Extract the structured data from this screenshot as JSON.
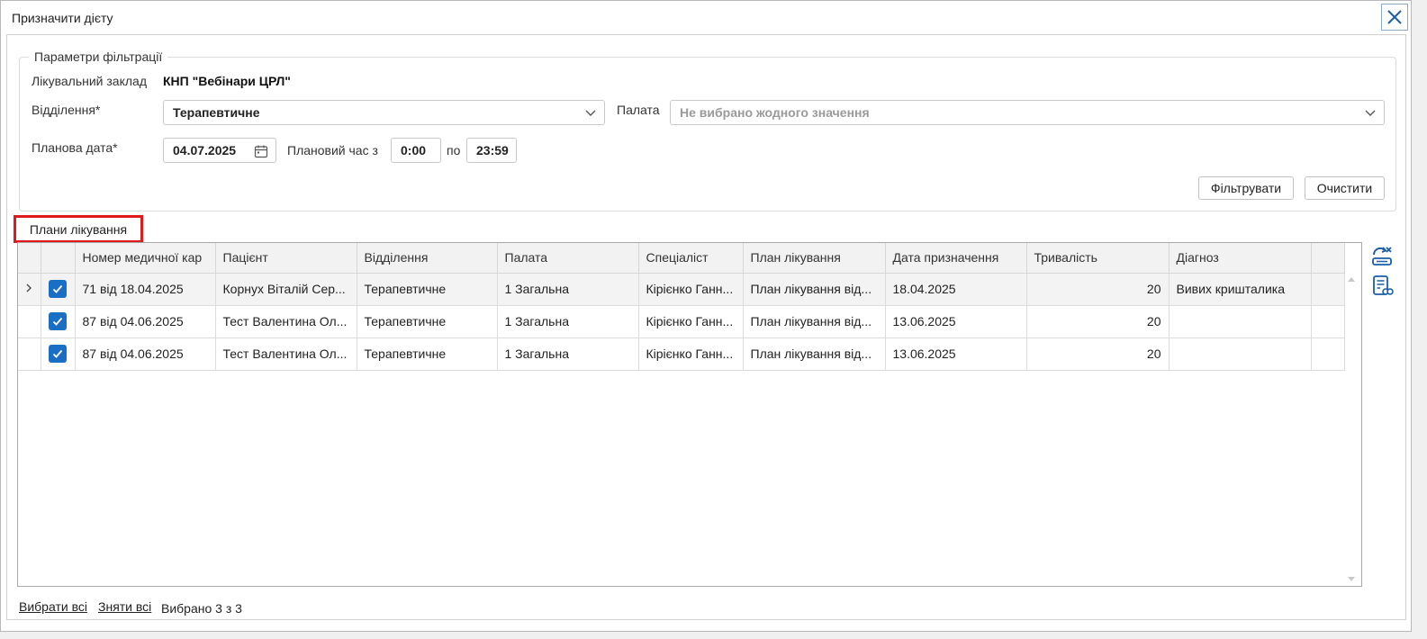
{
  "window": {
    "title": "Призначити дієту"
  },
  "filter": {
    "legend": "Параметри фільтрації",
    "facility_label": "Лікувальний заклад",
    "facility_value": "КНП \"Вебінари ЦРЛ\"",
    "department_label": "Відділення*",
    "department_value": "Терапевтичне",
    "ward_label": "Палата",
    "ward_placeholder": "Не вибрано жодного значення",
    "date_label": "Планова дата*",
    "date_value": "04.07.2025",
    "time_label": "Плановий час з",
    "time_from": "0:00",
    "time_to_label": "по",
    "time_to": "23:59",
    "filter_button": "Фільтрувати",
    "clear_button": "Очистити"
  },
  "tab": {
    "label": "Плани лікування"
  },
  "grid": {
    "columns": [
      "Номер медичної кар",
      "Пацієнт",
      "Відділення",
      "Палата",
      "Спеціаліст",
      "План лікування",
      "Дата призначення",
      "Тривалість",
      "Діагноз"
    ],
    "rows": [
      {
        "card": "71 від 18.04.2025",
        "patient": "Корнух Віталій Сер...",
        "department": "Терапевтичне",
        "ward": "1 Загальна",
        "specialist": "Кірієнко Ганн...",
        "plan": "План лікування від...",
        "date": "18.04.2025",
        "duration": "20",
        "diagnosis": "Вивих кришталика"
      },
      {
        "card": "87 від 04.06.2025",
        "patient": "Тест Валентина Ол...",
        "department": "Терапевтичне",
        "ward": "1 Загальна",
        "specialist": "Кірієнко Ганн...",
        "plan": "План лікування від...",
        "date": "13.06.2025",
        "duration": "20",
        "diagnosis": ""
      },
      {
        "card": "87 від 04.06.2025",
        "patient": "Тест Валентина Ол...",
        "department": "Терапевтичне",
        "ward": "1 Загальна",
        "specialist": "Кірієнко Ганн...",
        "plan": "План лікування від...",
        "date": "13.06.2025",
        "duration": "20",
        "diagnosis": ""
      }
    ]
  },
  "footer": {
    "select_all": "Вибрати всі",
    "deselect_all": "Зняти всі",
    "selected_count": "Вибрано 3 з 3"
  },
  "colors": {
    "accent": "#1a6fc4",
    "highlight_border": "#e01a1a"
  }
}
